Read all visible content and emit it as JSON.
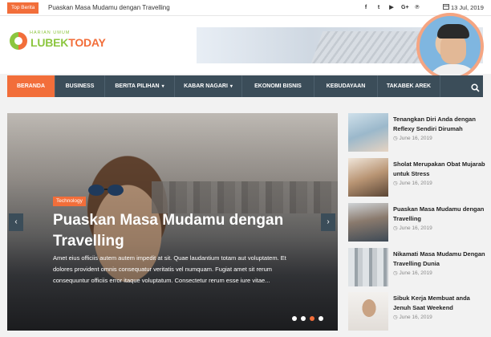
{
  "topbar": {
    "label": "Top Berita",
    "headline": "Puaskan Masa Mudamu dengan Travelling",
    "social_icons": [
      "facebook-icon",
      "twitter-icon",
      "youtube-icon",
      "google-plus-icon",
      "pinterest-icon"
    ],
    "social_glyphs": [
      "f",
      "t",
      "▶",
      "G+",
      "℗"
    ],
    "date": "13 Jul, 2019"
  },
  "header": {
    "logo_small": "HARIAN UMUM",
    "logo_part1": "LUBEK",
    "logo_part2": "TODAY"
  },
  "nav": {
    "items": [
      {
        "label": "BERANDA",
        "active": true,
        "dropdown": false
      },
      {
        "label": "BUSINESS",
        "active": false,
        "dropdown": false
      },
      {
        "label": "BERITA PILIHAN",
        "active": false,
        "dropdown": true
      },
      {
        "label": "KABAR NAGARI",
        "active": false,
        "dropdown": true
      },
      {
        "label": "EKONOMI BISNIS",
        "active": false,
        "dropdown": false
      },
      {
        "label": "KEBUDAYAAN",
        "active": false,
        "dropdown": false
      },
      {
        "label": "TAKABEK AREK",
        "active": false,
        "dropdown": false
      }
    ]
  },
  "slider": {
    "category": "Technology",
    "title": "Puaskan Masa Mudamu dengan Travelling",
    "excerpt": "Amet eius officiis autem autem impedit at sit. Quae laudantium totam aut voluptatem. Et dolores provident omnis consequatur veritatis vel numquam. Fugiat amet sit rerum consequuntur officiis error itaque voluptatum. Consectetur rerum esse iure vitae...",
    "prev_glyph": "‹",
    "next_glyph": "›",
    "dots": 4,
    "active_dot": 2
  },
  "sidebar": {
    "items": [
      {
        "title": "Tenangkan Diri Anda dengan Reflexy Sendiri Dirumah",
        "date": "June 16, 2019"
      },
      {
        "title": "Sholat Merupakan Obat Mujarab untuk Stress",
        "date": "June 16, 2019"
      },
      {
        "title": "Puaskan Masa Mudamu dengan Travelling",
        "date": "June 16, 2019"
      },
      {
        "title": "Nikamati Masa Mudamu Dengan Travelling Dunia",
        "date": "June 16, 2019"
      },
      {
        "title": "Sibuk Kerja Membuat anda Jenuh Saat Weekend",
        "date": "June 16, 2019"
      }
    ]
  },
  "colors": {
    "accent": "#f26e3a",
    "nav_bg": "#3b4d59",
    "logo_green": "#8cc63f"
  }
}
